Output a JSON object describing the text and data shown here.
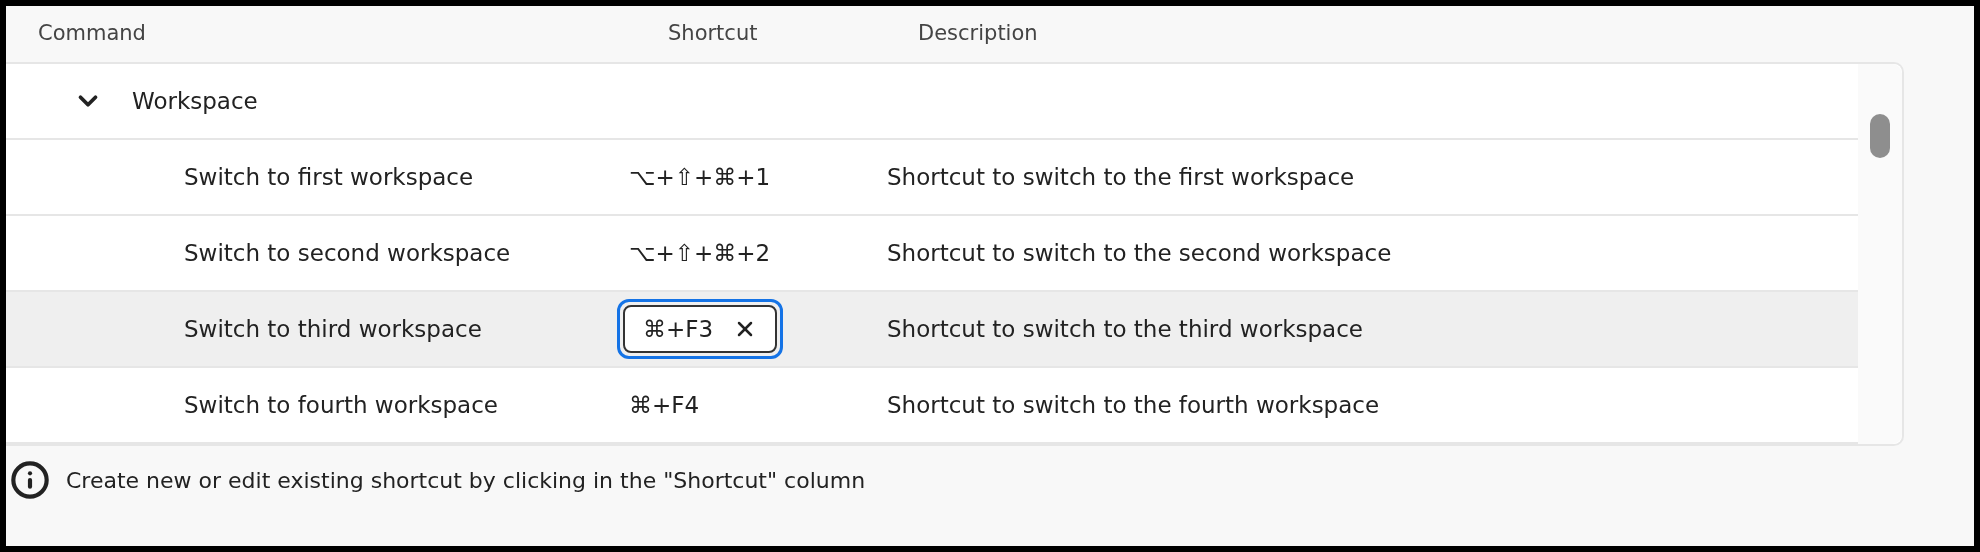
{
  "columns": [
    "Command",
    "Shortcut",
    "Description"
  ],
  "groups": [
    {
      "label": "Workspace",
      "expanded": true,
      "rows": [
        {
          "command": "Switch to first workspace",
          "shortcut": "⌥+⇧+⌘+1",
          "description": "Shortcut to switch to the first workspace",
          "selected": false
        },
        {
          "command": "Switch to second workspace",
          "shortcut": "⌥+⇧+⌘+2",
          "description": "Shortcut to switch to the second workspace",
          "selected": false
        },
        {
          "command": "Switch to third workspace",
          "shortcut": "⌘+F3",
          "description": "Shortcut to switch to the third workspace",
          "selected": true
        },
        {
          "command": "Switch to fourth workspace",
          "shortcut": "⌘+F4",
          "description": "Shortcut to switch to the fourth workspace",
          "selected": false
        }
      ]
    }
  ],
  "info": "Create new or edit existing shortcut by clicking in the \"Shortcut\" column"
}
